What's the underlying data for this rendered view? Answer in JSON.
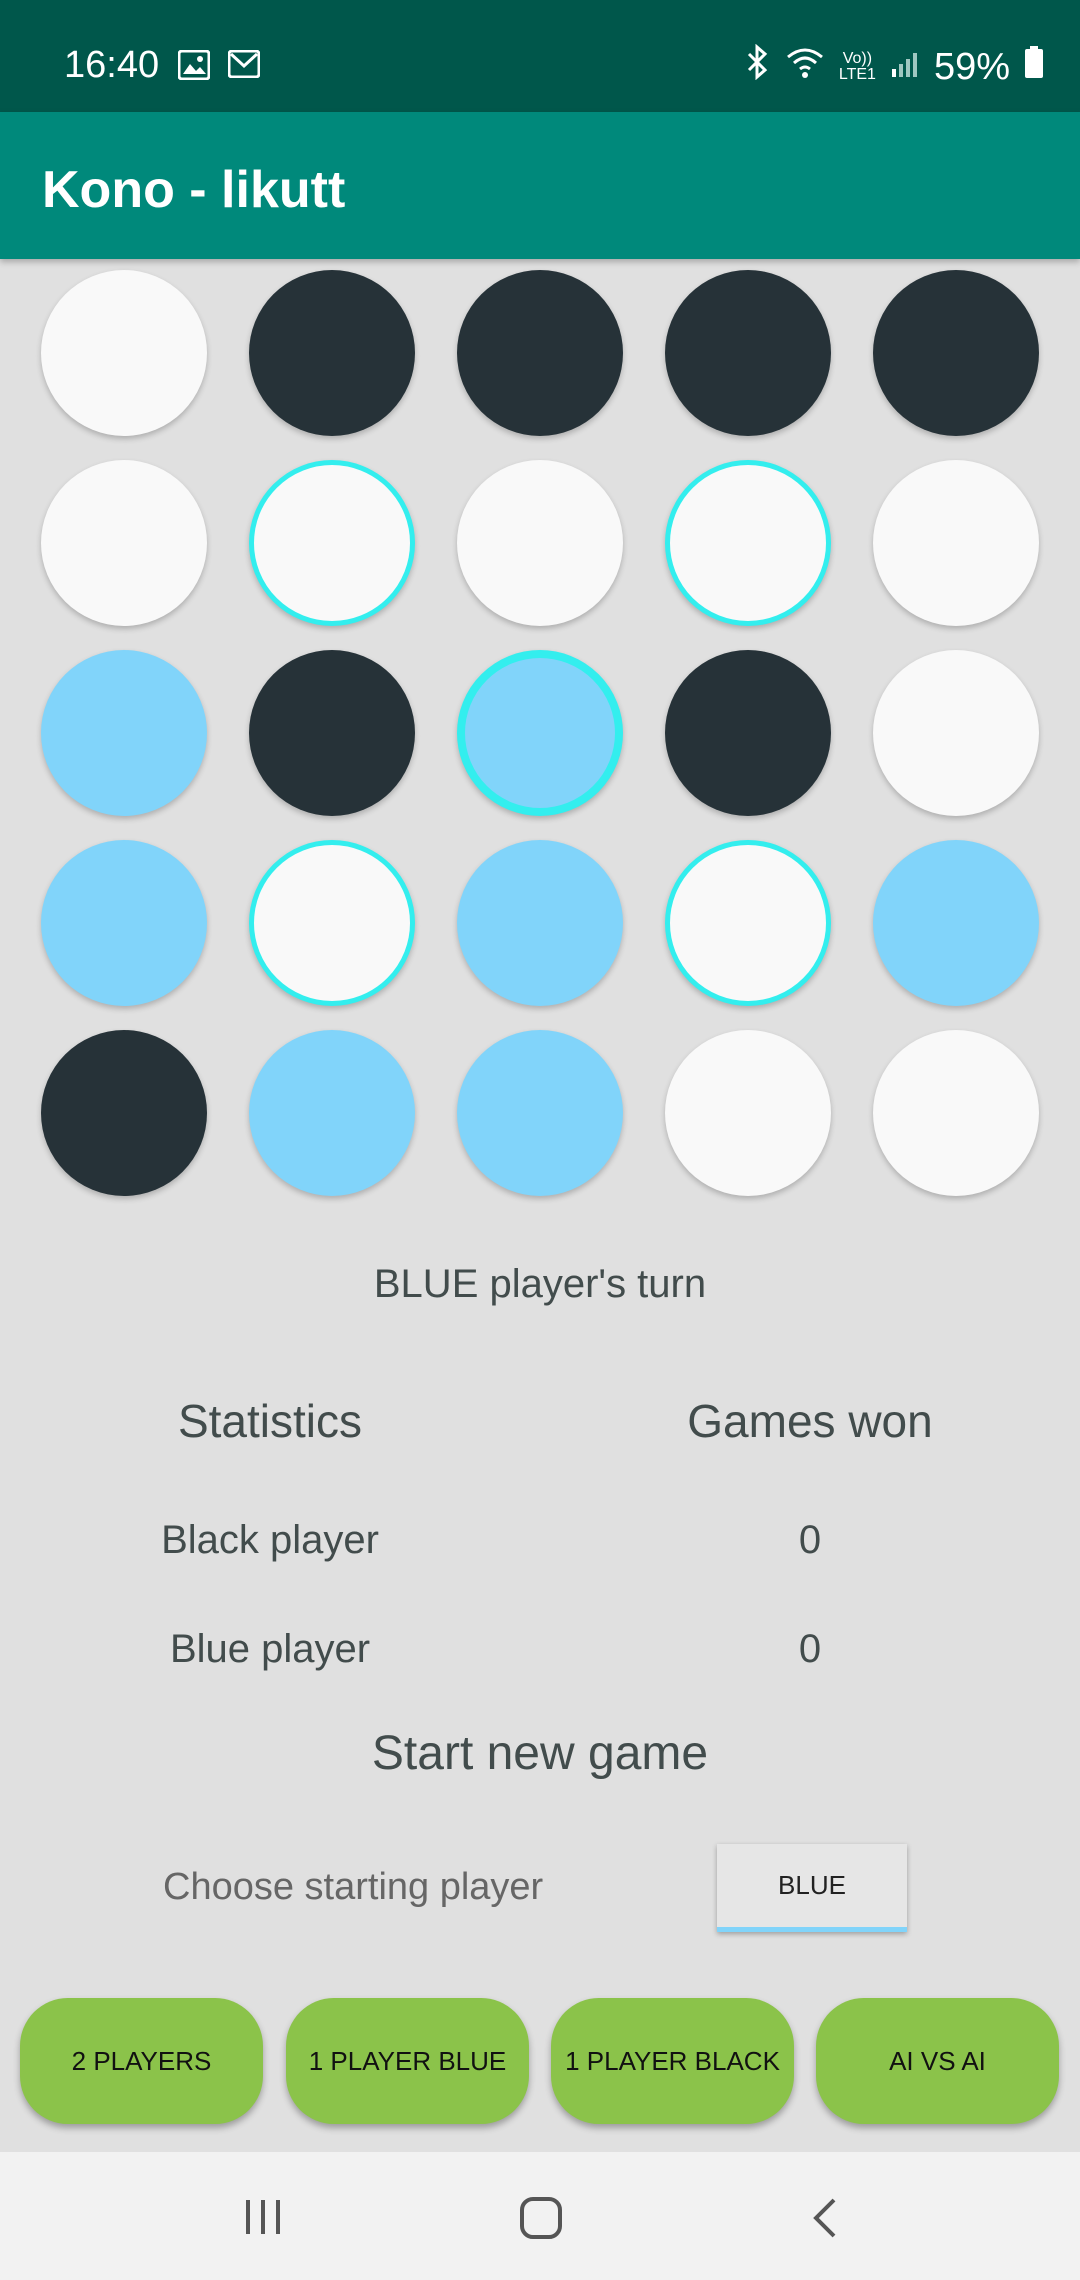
{
  "status_bar": {
    "time": "16:40",
    "battery": "59%",
    "network_label": "LTE1",
    "volte_label": "Vo))",
    "icons": [
      "image-icon",
      "gmail-icon",
      "bluetooth-icon",
      "wifi-icon",
      "signal-icon",
      "battery-icon"
    ]
  },
  "app": {
    "title": "Kono - likutt"
  },
  "board": {
    "rows": [
      [
        "white",
        "black",
        "black",
        "black",
        "black"
      ],
      [
        "white",
        "white-highlight",
        "white",
        "white-highlight",
        "white"
      ],
      [
        "blue",
        "black",
        "blue-selected",
        "black",
        "white"
      ],
      [
        "blue",
        "white-highlight",
        "blue",
        "white-highlight",
        "blue"
      ],
      [
        "black",
        "blue",
        "blue",
        "white",
        "white"
      ]
    ]
  },
  "turn_text": "BLUE player's turn",
  "stats": {
    "header_left": "Statistics",
    "header_right": "Games won",
    "black_label": "Black player",
    "black_value": "0",
    "blue_label": "Blue player",
    "blue_value": "0"
  },
  "new_game": {
    "title": "Start new game",
    "choose_label": "Choose starting player",
    "starting_player": "BLUE"
  },
  "modes": [
    "2 PLAYERS",
    "1 PLAYER BLUE",
    "1 PLAYER BLACK",
    "AI VS AI"
  ],
  "colors": {
    "status_bar": "#00574b",
    "app_bar": "#00897b",
    "black_piece": "#263238",
    "white_piece": "#f9f9f9",
    "blue_piece": "#81d4fa",
    "highlight": "#33eeee",
    "mode_button": "#8bc34a"
  }
}
